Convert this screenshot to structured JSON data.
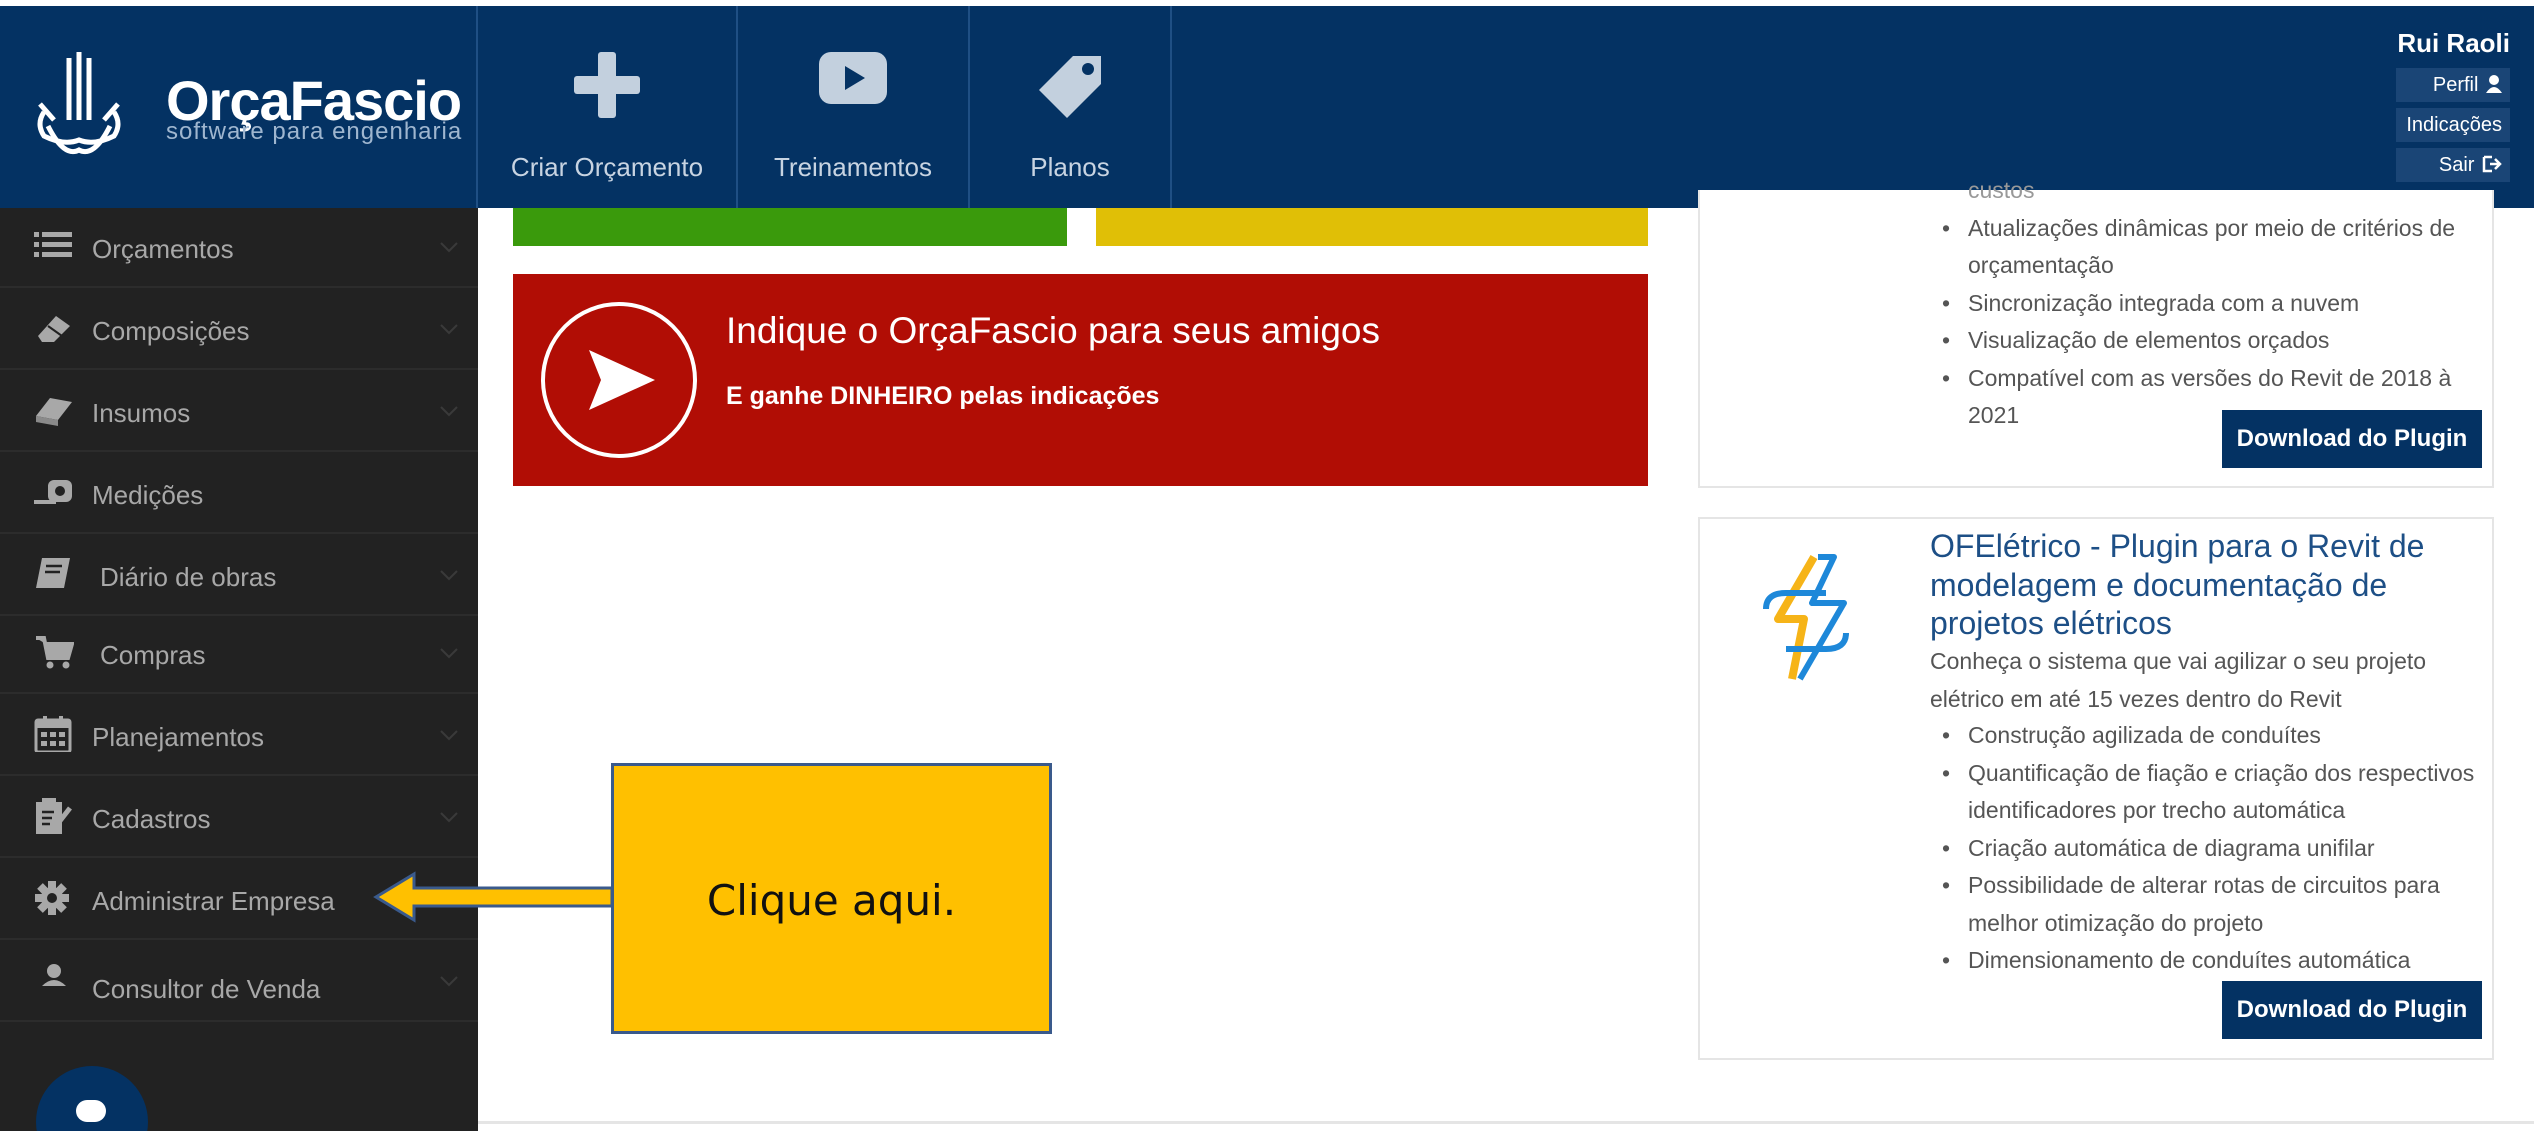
{
  "brand": {
    "name": "OrçaFascio",
    "tagline": "software para engenharia"
  },
  "topnav": [
    {
      "label": "Criar Orçamento",
      "icon": "plus-icon"
    },
    {
      "label": "Treinamentos",
      "icon": "play-icon"
    },
    {
      "label": "Planos",
      "icon": "tag-icon"
    }
  ],
  "user": {
    "name": "Rui Raoli",
    "links": [
      "Perfil",
      "Indicações",
      "Sair"
    ]
  },
  "sidebar": {
    "items": [
      {
        "label": "Orçamentos",
        "icon": "list-icon"
      },
      {
        "label": "Composições",
        "icon": "eraser-icon"
      },
      {
        "label": "Insumos",
        "icon": "block-icon"
      },
      {
        "label": "Medições",
        "icon": "tape-measure-icon"
      },
      {
        "label": "Diário de obras",
        "icon": "book-icon"
      },
      {
        "label": "Compras",
        "icon": "cart-icon"
      },
      {
        "label": "Planejamentos",
        "icon": "calendar-icon"
      },
      {
        "label": "Cadastros",
        "icon": "clipboard-icon"
      },
      {
        "label": "Administrar Empresa",
        "icon": "gear-icon"
      },
      {
        "label": "Consultor de Venda",
        "icon": "user-icon"
      }
    ]
  },
  "referral": {
    "title": "Indique o OrçaFascio para seus amigos",
    "subtitle": "E ganhe DINHEIRO pelas indicações"
  },
  "plugin_card_top": {
    "partial_line": "custos",
    "bullets": [
      "Atualizações dinâmicas por meio de critérios de orçamentação",
      "Sincronização integrada com a nuvem",
      "Visualização de elementos orçados",
      "Compatível com as versões do Revit de 2018 à 2021"
    ],
    "button": "Download do Plugin"
  },
  "plugin_card_bottom": {
    "title": "OFElétrico - Plugin para o Revit de modelagem e documentação de projetos elétricos",
    "description": "Conheça o sistema que vai agilizar o seu projeto elétrico em até 15 vezes dentro do Revit",
    "bullets": [
      "Construção agilizada de conduítes",
      "Quantificação de fiação e criação dos respectivos identificadores por trecho automática",
      "Criação automática de diagrama unifilar",
      "Possibilidade de alterar rotas de circuitos para melhor otimização do projeto",
      "Dimensionamento de conduítes automática"
    ],
    "button": "Download do Plugin"
  },
  "annotation": {
    "text": "Clique aqui."
  },
  "colors": {
    "header": "#043263",
    "sidebar": "#222222",
    "green_tile": "#3a9a0c",
    "yellow_tile": "#e0bf06",
    "referral": "#b10d05",
    "callout": "#ffc000"
  }
}
